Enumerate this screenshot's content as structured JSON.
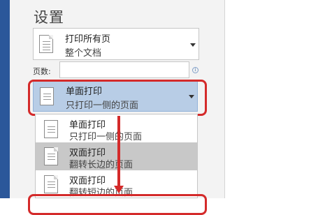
{
  "panel": {
    "title": "设置"
  },
  "print_range": {
    "primary": "打印所有页",
    "secondary": "整个文档",
    "icon": "document-pages-icon"
  },
  "pages": {
    "label": "页数:",
    "value": "",
    "placeholder": "",
    "info_icon": "info-icon"
  },
  "duplex": {
    "primary": "单面打印",
    "secondary": "只打印一侧的页面",
    "icon": "single-sided-icon",
    "options": [
      {
        "primary": "单面打印",
        "secondary": "只打印一侧的页面",
        "icon": "single-sided-icon",
        "selected": false
      },
      {
        "primary": "双面打印",
        "secondary": "翻转长边的页面",
        "icon": "duplex-long-edge-icon",
        "selected": true
      },
      {
        "primary": "双面打印",
        "secondary": "翻转短边的页面",
        "icon": "duplex-short-edge-icon",
        "selected": false
      }
    ]
  },
  "colors": {
    "accent": "#2b579a",
    "selection": "#b8cde6",
    "annotation": "#d42a2a",
    "hover": "#c8c8c8"
  }
}
